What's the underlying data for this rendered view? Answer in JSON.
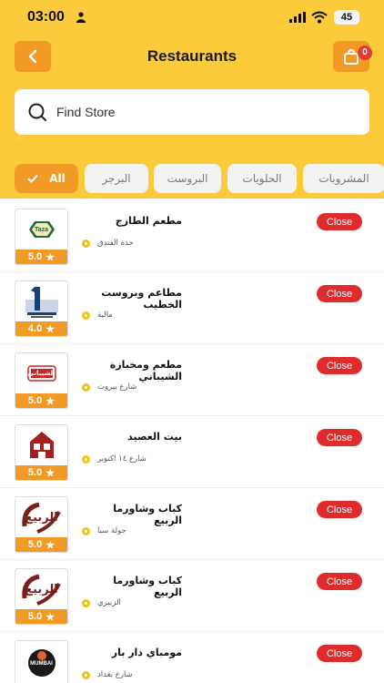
{
  "status_bar": {
    "time": "03:00",
    "battery": "45"
  },
  "header": {
    "title": "Restaurants",
    "cart_count": "0"
  },
  "search": {
    "placeholder": "Find Store"
  },
  "filters": [
    {
      "label": "All",
      "active": true
    },
    {
      "label": "البرجر"
    },
    {
      "label": "البروست"
    },
    {
      "label": "الحلويات"
    },
    {
      "label": "المشروبات"
    }
  ],
  "restaurants": [
    {
      "name": "مطعم الطازج",
      "address": "حدة الفندق",
      "rating": "5.0",
      "status": "Close",
      "logo_text": "Taza"
    },
    {
      "name": "مطاعم وبروست الخطيب",
      "address": "مالية",
      "rating": "4.0",
      "status": "Close",
      "logo_text": ""
    },
    {
      "name": "مطعم ومخبازة الشيباني",
      "address": "شارع بيروت",
      "rating": "5.0",
      "status": "Close",
      "logo_text": "الشيباني"
    },
    {
      "name": "بيت العصيد",
      "address": "شارع ١٤ اكتوبر",
      "rating": "5.0",
      "status": "Close",
      "logo_text": ""
    },
    {
      "name": "كباب وشاورما الربيع",
      "address": "جولة سبا",
      "rating": "5.0",
      "status": "Close",
      "logo_text": "الربيع"
    },
    {
      "name": "كباب وشاورما الربيع",
      "address": "الزبيري",
      "rating": "5.0",
      "status": "Close",
      "logo_text": "الربيع"
    },
    {
      "name": "مومباي دار بار",
      "address": "شارع بغداد",
      "rating": "",
      "status": "Close",
      "logo_text": "MUMBAI"
    }
  ]
}
